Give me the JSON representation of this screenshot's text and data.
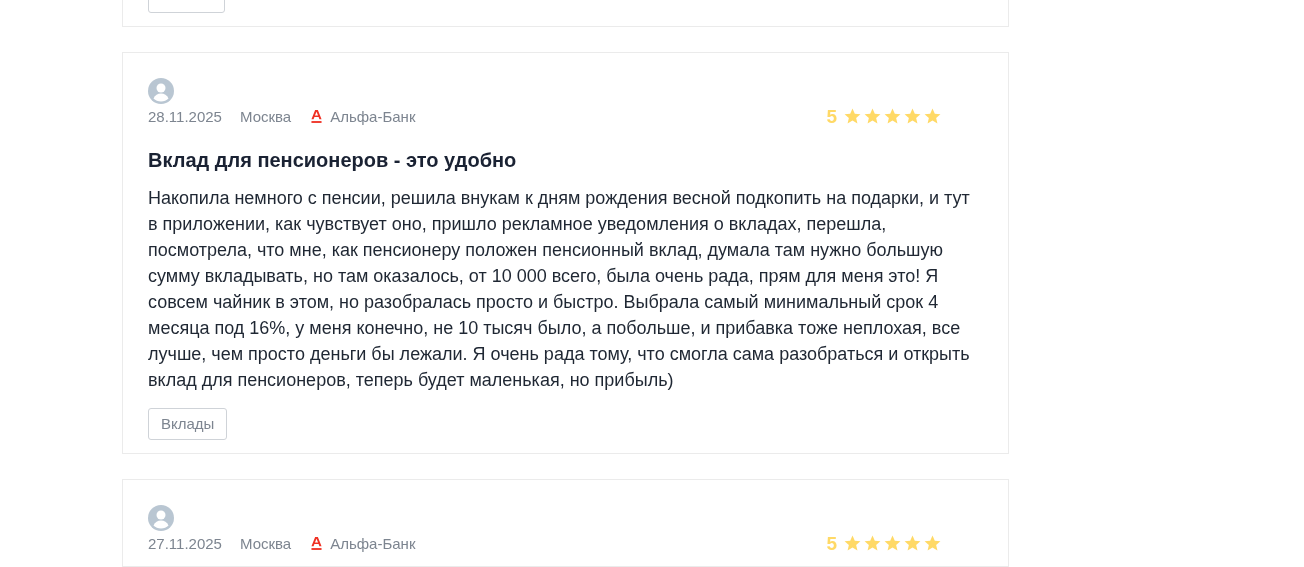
{
  "reviews": [
    {
      "kind": "cut"
    },
    {
      "kind": "full",
      "date": "28.11.2025",
      "city": "Москва",
      "bank": "Альфа-Банк",
      "rating": "5",
      "stars": 5,
      "title": "Вклад для пенсионеров - это удобно",
      "text": "Накопила немного с пенсии, решила внукам к дням рождения весной подкопить на подарки, и тут в приложении, как чувствует оно, пришло рекламное уведомления о вкладах, перешла, посмотрела, что мне, как пенсионеру положен пенсионный вклад, думала там нужно большую сумму вкладывать, но там оказалось, от 10 000 всего, была очень рада, прям для меня это! Я совсем чайник в этом, но разобралась просто и быстро. Выбрала самый минимальный срок 4 месяца под 16%, у меня конечно, не 10 тысяч было, а побольше, и прибавка тоже неплохая, все лучше, чем просто деньги бы лежали. Я очень рада тому, что смогла сама разобраться и открыть вклад для пенсионеров, теперь будет маленькая, но прибыль)",
      "tags": [
        "Вклады"
      ]
    },
    {
      "kind": "full",
      "date": "27.11.2025",
      "city": "Москва",
      "bank": "Альфа-Банк",
      "rating": "5",
      "stars": 5
    }
  ]
}
